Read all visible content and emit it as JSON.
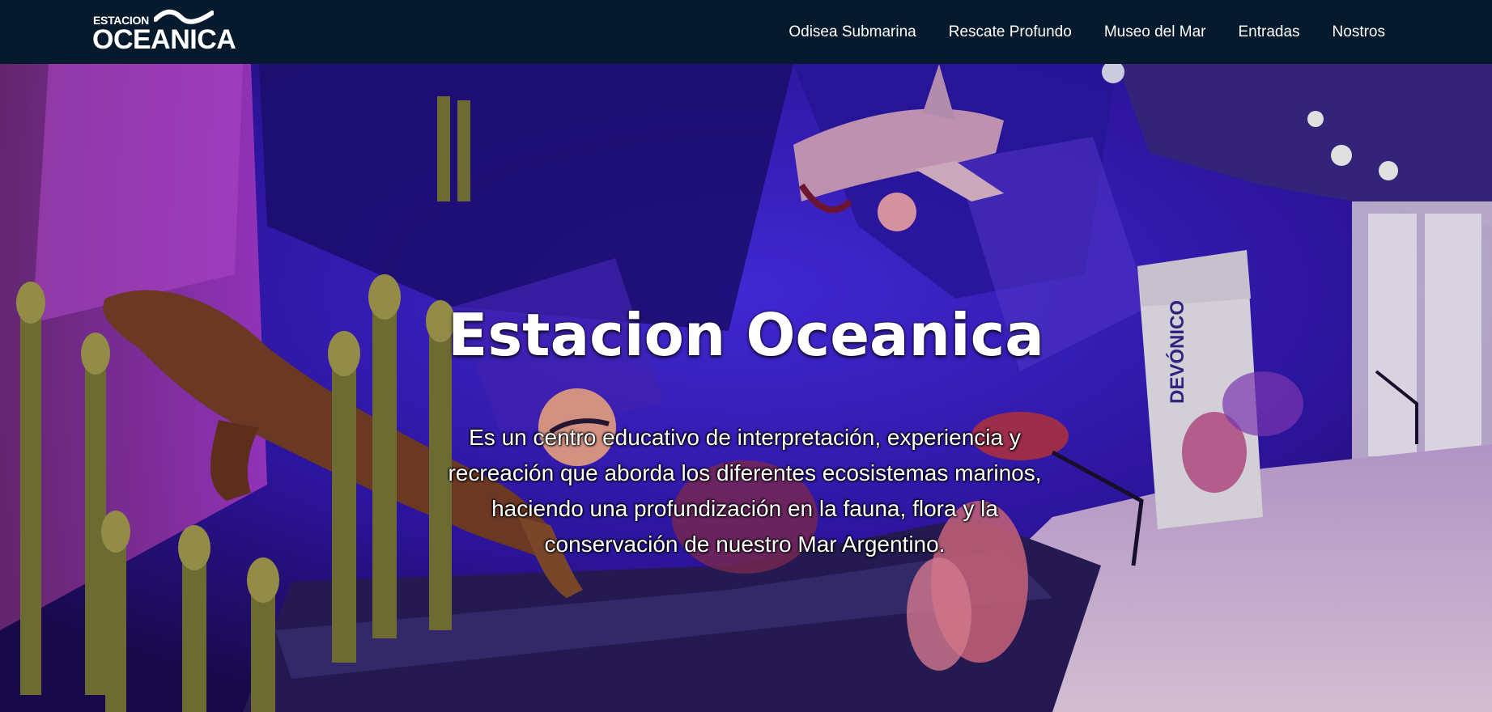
{
  "brand": {
    "line1": "ESTACION",
    "line2": "OCEANICA"
  },
  "nav": {
    "items": [
      {
        "label": "Odisea Submarina"
      },
      {
        "label": "Rescate Profundo"
      },
      {
        "label": "Museo del Mar"
      },
      {
        "label": "Entradas"
      },
      {
        "label": "Nostros"
      }
    ]
  },
  "hero": {
    "title": "Estacion Oceanica",
    "description": "Es un centro educativo de interpretación, experiencia y recreación que aborda los diferentes ecosistemas marinos, haciendo una profundización en la fauna, flora y la conservación de nuestro Mar Argentino.",
    "panel_text": "DEVÓNICO"
  },
  "colors": {
    "navbar_bg": "#051a2c",
    "hero_purple": "#3a1cc4",
    "text": "#ffffff"
  }
}
